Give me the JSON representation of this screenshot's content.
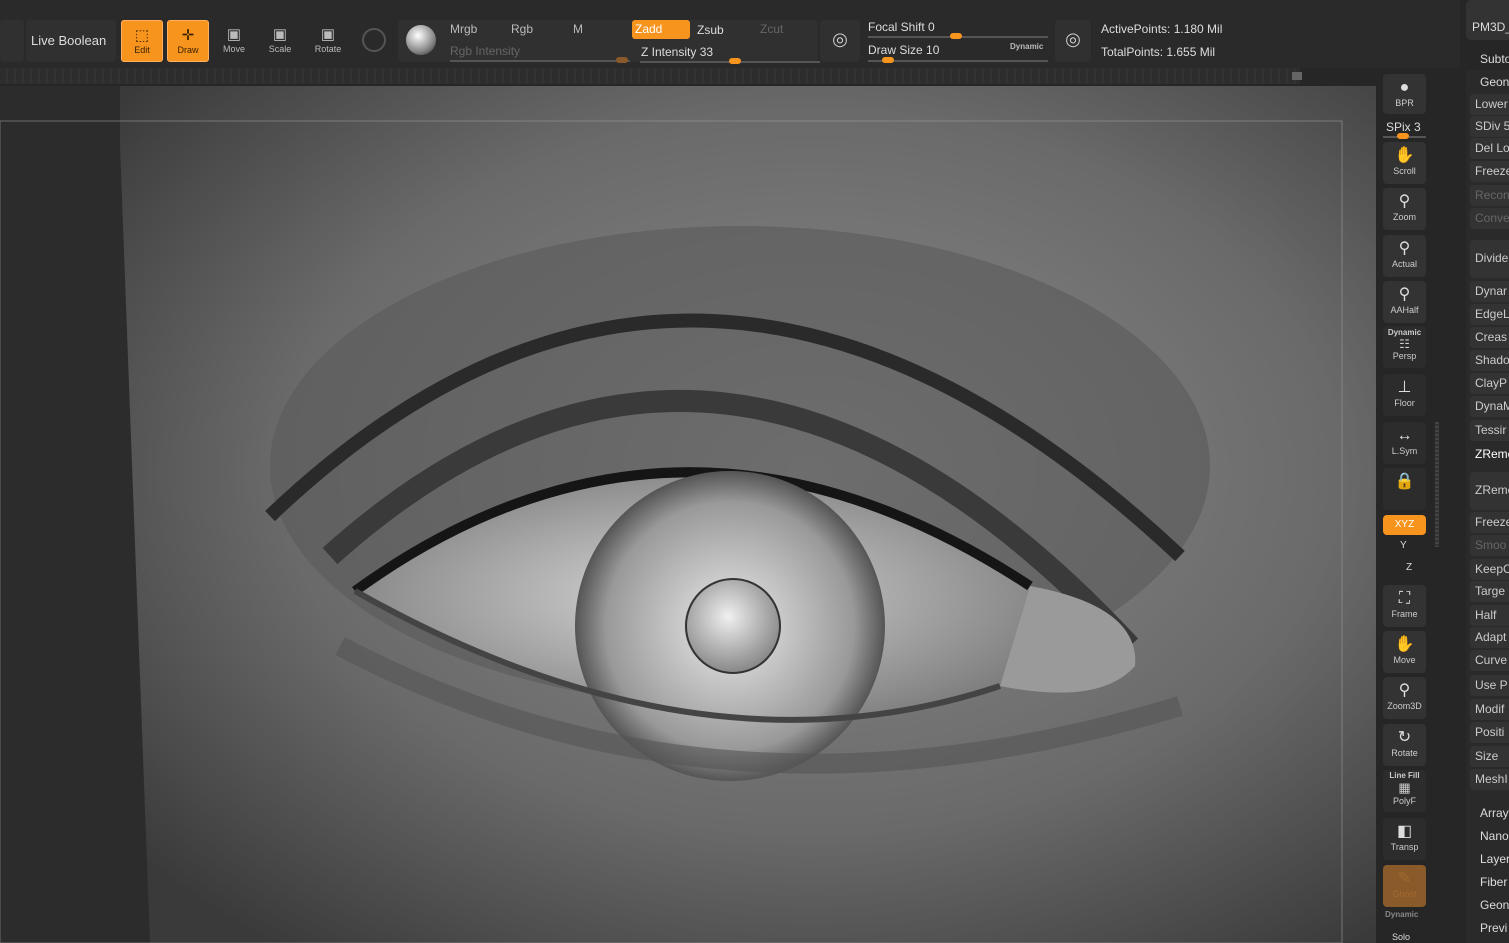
{
  "toolbar": {
    "live_boolean": "Live Boolean",
    "edit": "Edit",
    "draw": "Draw",
    "move": "Move",
    "scale": "Scale",
    "rotate": "Rotate",
    "mrgb": "Mrgb",
    "rgb": "Rgb",
    "m": "M",
    "zadd": "Zadd",
    "zsub": "Zsub",
    "zcut": "Zcut",
    "rgb_intensity": "Rgb Intensity",
    "z_intensity": "Z Intensity 33",
    "focal_shift": "Focal Shift 0",
    "draw_size": "Draw Size 10",
    "dynamic": "Dynamic",
    "active_points": "ActivePoints: 1.180 Mil",
    "total_points": "TotalPoints: 1.655 Mil",
    "z_intensity_value": 33,
    "focal_shift_value": 0,
    "draw_size_value": 10
  },
  "right_tools": {
    "bpr": "BPR",
    "spix": "SPix 3",
    "scroll": "Scroll",
    "zoom": "Zoom",
    "actual": "Actual",
    "aahalf": "AAHalf",
    "dynamic": "Dynamic",
    "persp": "Persp",
    "floor": "Floor",
    "lsym": "L.Sym",
    "xyz": "XYZ",
    "y": "Y",
    "z": "Z",
    "frame": "Frame",
    "move": "Move",
    "zoom3d": "Zoom3D",
    "rotate": "Rotate",
    "linefill": "Line Fill",
    "polyf": "PolyF",
    "transp": "Transp",
    "ghost": "Ghost",
    "dynamic2": "Dynamic",
    "solo": "Solo"
  },
  "panel": {
    "pm3d": "PM3D_",
    "subtool": "Subto",
    "geometry": "Geon",
    "items": [
      "Lower",
      "SDiv 5",
      "Del Lo",
      "Freeze",
      "Recon",
      "Conve",
      "Divide",
      "Dynar",
      "EdgeL",
      "Creas",
      "Shado",
      "ClayP",
      "DynaM",
      "Tessir",
      "ZReme",
      "ZReme",
      "Freeze",
      "Smoo",
      "KeepC",
      "Targe",
      "Half",
      "Adapt",
      "Curve",
      "Use P",
      "Modif",
      "Positi",
      "Size",
      "MeshI"
    ],
    "sections": [
      "Array",
      "Nano",
      "Layer",
      "Fiber",
      "Geon",
      "Previ"
    ]
  }
}
